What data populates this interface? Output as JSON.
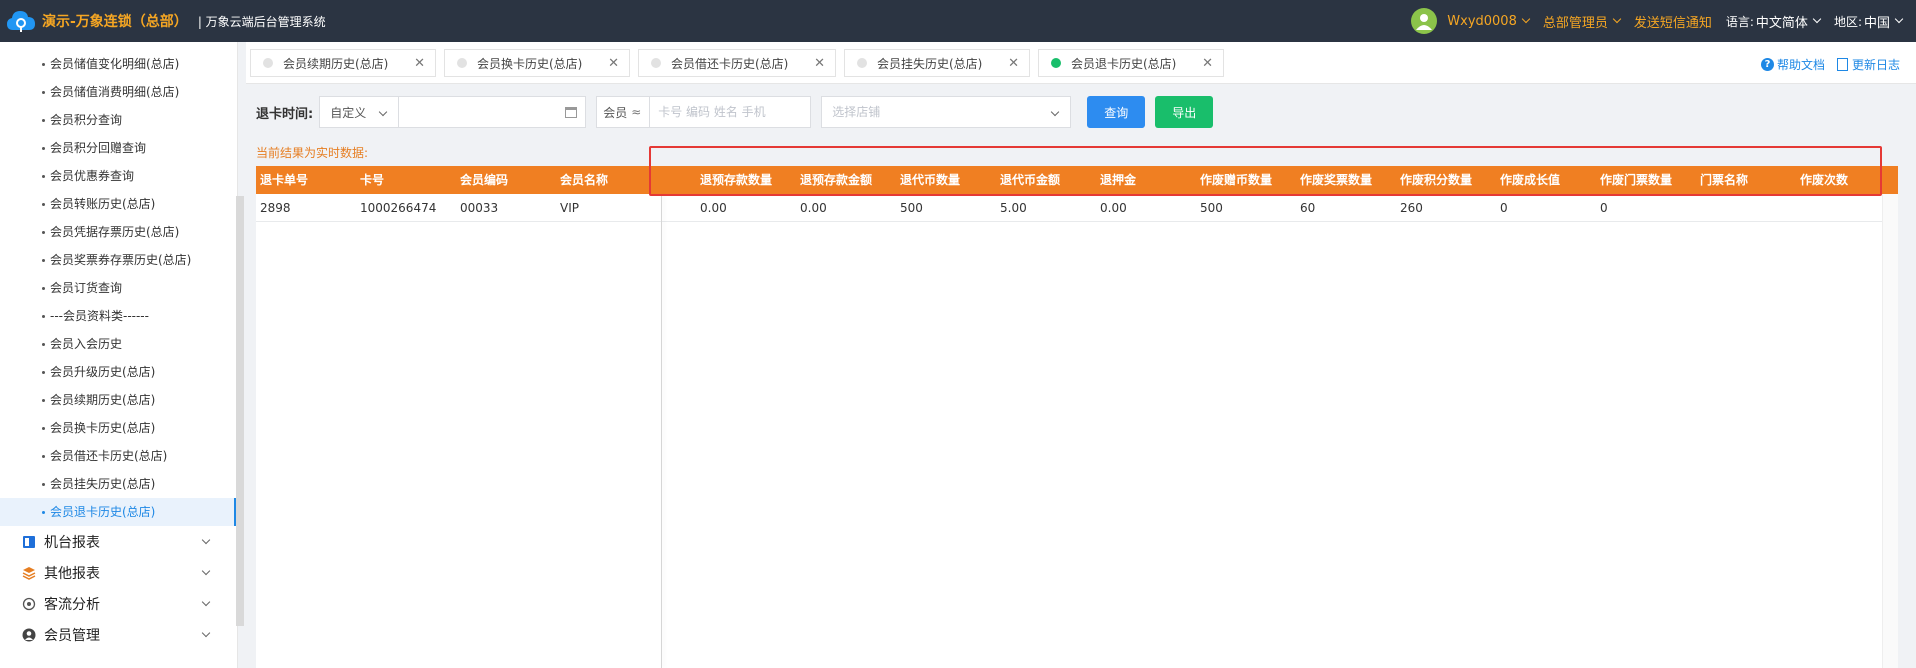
{
  "header": {
    "brand": "演示-万象连锁（总部）",
    "system_name": "| 万象云端后台管理系统",
    "username": "Wxyd0008",
    "role": "总部管理员",
    "sms_link": "发送短信通知",
    "language_label": "语言:",
    "language_value": "中文简体",
    "region_label": "地区:",
    "region_value": "中国"
  },
  "sidebar": {
    "items": [
      {
        "label": "会员储值变化明细(总店)"
      },
      {
        "label": "会员储值消费明细(总店)"
      },
      {
        "label": "会员积分查询"
      },
      {
        "label": "会员积分回赠查询"
      },
      {
        "label": "会员优惠券查询"
      },
      {
        "label": "会员转账历史(总店)"
      },
      {
        "label": "会员凭据存票历史(总店)"
      },
      {
        "label": "会员奖票券存票历史(总店)"
      },
      {
        "label": "会员订货查询"
      },
      {
        "label": "---会员资料类------"
      },
      {
        "label": "会员入会历史"
      },
      {
        "label": "会员升级历史(总店)"
      },
      {
        "label": "会员续期历史(总店)"
      },
      {
        "label": "会员换卡历史(总店)"
      },
      {
        "label": "会员借还卡历史(总店)"
      },
      {
        "label": "会员挂失历史(总店)"
      },
      {
        "label": "会员退卡历史(总店)"
      }
    ],
    "groups": [
      {
        "label": "机台报表",
        "icon": "machine-report-icon"
      },
      {
        "label": "其他报表",
        "icon": "layers-icon"
      },
      {
        "label": "客流分析",
        "icon": "target-icon"
      },
      {
        "label": "会员管理",
        "icon": "user-icon"
      }
    ]
  },
  "tabs": [
    {
      "label": "会员续期历史(总店)"
    },
    {
      "label": "会员换卡历史(总店)"
    },
    {
      "label": "会员借还卡历史(总店)"
    },
    {
      "label": "会员挂失历史(总店)"
    },
    {
      "label": "会员退卡历史(总店)"
    }
  ],
  "help": {
    "doc": "帮助文档",
    "log": "更新日志"
  },
  "filter": {
    "time_label": "退卡时间:",
    "range_type": "自定义",
    "date_placeholder": "",
    "member_type": "会员",
    "member_placeholder": "卡号 编码 姓名 手机",
    "store_placeholder": "选择店铺",
    "search_button": "查询",
    "export_button": "导出"
  },
  "notice": "当前结果为实时数据:",
  "table": {
    "columns": [
      "退卡单号",
      "卡号",
      "会员编码",
      "会员名称",
      "退预存款数量",
      "退预存款金额",
      "退代币数量",
      "退代币金额",
      "退押金",
      "作废赠币数量",
      "作废奖票数量",
      "作废积分数量",
      "作废成长值",
      "作废门票数量",
      "门票名称",
      "作废次数"
    ],
    "rows": [
      [
        "2898",
        "1000266474",
        "00033",
        "VIP",
        "0.00",
        "0.00",
        "500",
        "5.00",
        "0.00",
        "500",
        "60",
        "260",
        "0",
        "0",
        "",
        ""
      ]
    ]
  },
  "colors": {
    "topbar": "#2b3442",
    "brand": "#f5a623",
    "table_header": "#f07f22",
    "search_button": "#2d8cf0",
    "export_button": "#19be6b",
    "active_tab_dot": "#19be6b",
    "highlight_box": "#e53935"
  }
}
